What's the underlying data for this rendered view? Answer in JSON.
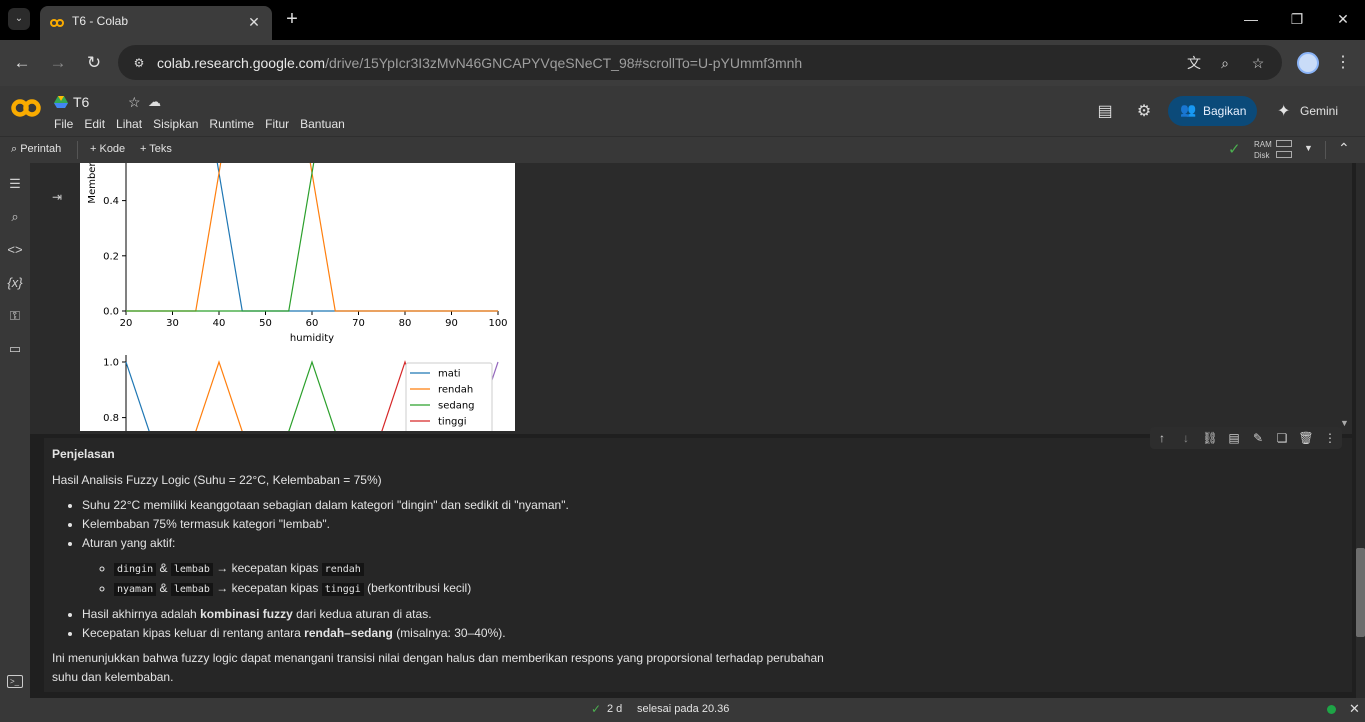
{
  "browser": {
    "tab_title": "T6 - Colab",
    "url_host": "colab.research.google.com",
    "url_path": "/drive/15YpIcr3I3zMvN46GNCAPYVqeSNeCT_98#scrollTo=U-pYUmmf3mnh",
    "icons": [
      "translate-icon",
      "zoom-icon",
      "bookmark-star-icon",
      "profile-avatar",
      "more-icon"
    ]
  },
  "colab": {
    "notebook_title": "T6",
    "menu": [
      "File",
      "Edit",
      "Lihat",
      "Sisipkan",
      "Runtime",
      "Fitur",
      "Bantuan"
    ],
    "share_label": "Bagikan",
    "gemini_label": "Gemini",
    "brand_color": "#f9ab00"
  },
  "toolbar": {
    "command_label": "Perintah",
    "add_code_label": "+ Kode",
    "add_text_label": "+ Teks",
    "ram_label": "RAM",
    "disk_label": "Disk"
  },
  "plot_top": {
    "ylabel": "Member",
    "xlabel": "humidity",
    "yticks": [
      "0.4",
      "0.2",
      "0.0"
    ],
    "xticks": [
      "20",
      "30",
      "40",
      "50",
      "60",
      "70",
      "80",
      "90",
      "100"
    ]
  },
  "plot_bottom": {
    "yticks": [
      "1.0",
      "0.8"
    ],
    "legend": [
      "mati",
      "rendah",
      "sedang",
      "tinggi"
    ]
  },
  "chart_data": [
    {
      "type": "line",
      "xlabel": "humidity",
      "ylabel": "Member",
      "xlim": [
        20,
        100
      ],
      "ylim": [
        0,
        1
      ],
      "series": [
        {
          "color": "#1f77b4",
          "x": [
            20,
            35,
            45,
            100
          ],
          "y": [
            1,
            1,
            0,
            0
          ]
        },
        {
          "color": "#ff7f0e",
          "x": [
            20,
            35,
            45,
            55,
            65,
            100
          ],
          "y": [
            0,
            0,
            1,
            1,
            0,
            0
          ]
        },
        {
          "color": "#2ca02c",
          "x": [
            20,
            55,
            65,
            100
          ],
          "y": [
            0,
            0,
            1,
            1
          ]
        }
      ]
    },
    {
      "type": "line",
      "legend": [
        "mati",
        "rendah",
        "sedang",
        "tinggi"
      ],
      "ylim": [
        0,
        1
      ],
      "series": [
        {
          "name": "mati",
          "color": "#1f77b4",
          "x": [
            0,
            25
          ],
          "y": [
            1,
            0
          ]
        },
        {
          "name": "rendah",
          "color": "#ff7f0e",
          "x": [
            0,
            25,
            50
          ],
          "y": [
            0,
            1,
            0
          ]
        },
        {
          "name": "sedang",
          "color": "#2ca02c",
          "x": [
            25,
            50,
            75
          ],
          "y": [
            0,
            1,
            0
          ]
        },
        {
          "name": "tinggi",
          "color": "#d62728",
          "x": [
            50,
            75,
            100
          ],
          "y": [
            0,
            1,
            0
          ]
        },
        {
          "color": "#9467bd",
          "x": [
            75,
            100
          ],
          "y": [
            0,
            1
          ]
        }
      ]
    }
  ],
  "markdown": {
    "heading": "Penjelasan",
    "intro": "Hasil Analisis Fuzzy Logic (Suhu = 22°C, Kelembaban = 75%)",
    "bullet1": "Suhu 22°C memiliki keanggotaan sebagian dalam kategori \"dingin\" dan sedikit di \"nyaman\".",
    "bullet2": "Kelembaban 75% termasuk kategori \"lembab\".",
    "bullet3": "Aturan yang aktif:",
    "rule1": {
      "a": "dingin",
      "amp": "&",
      "b": "lembab",
      "arrow": "→ kecepatan kipas",
      "c": "rendah",
      "tail": ""
    },
    "rule2": {
      "a": "nyaman",
      "amp": "&",
      "b": "lembab",
      "arrow": "→ kecepatan kipas",
      "c": "tinggi",
      "tail": "(berkontribusi kecil)"
    },
    "bullet4_pre": "Hasil akhirnya adalah ",
    "bullet4_bold": "kombinasi fuzzy",
    "bullet4_post": " dari kedua aturan di atas.",
    "bullet5_pre": "Kecepatan kipas keluar di rentang antara ",
    "bullet5_bold": "rendah–sedang",
    "bullet5_post": " (misalnya: 30–40%).",
    "conclusion": "Ini menunjukkan bahwa fuzzy logic dapat menangani transisi nilai dengan halus dan memberikan respons yang proporsional terhadap perubahan suhu dan kelembaban."
  },
  "status": {
    "duration": "2 d",
    "done_text": "selesai pada 20.36"
  }
}
